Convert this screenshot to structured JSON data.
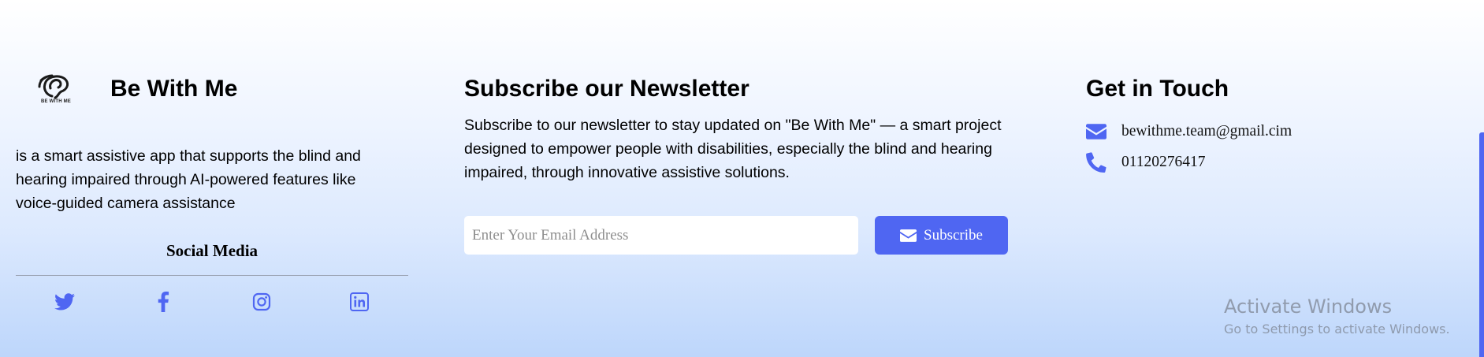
{
  "brand": {
    "logo_caption": "BE WITH ME",
    "title": "Be With Me",
    "description": "is a smart assistive app that supports the blind and hearing impaired through AI-powered features like voice-guided camera assistance"
  },
  "social": {
    "title": "Social Media",
    "links": [
      {
        "icon": "twitter-icon"
      },
      {
        "icon": "facebook-icon"
      },
      {
        "icon": "instagram-icon"
      },
      {
        "icon": "linkedin-icon"
      }
    ]
  },
  "newsletter": {
    "title": "Subscribe our Newsletter",
    "description": "Subscribe to our newsletter to stay updated on \"Be With Me\" — a smart project designed to empower people with disabilities, especially the blind and hearing impaired, through innovative assistive solutions.",
    "email_placeholder": "Enter Your Email Address",
    "email_value": "",
    "button_label": "Subscribe",
    "button_icon": "envelope-icon"
  },
  "contact": {
    "title": "Get in Touch",
    "email": "bewithme.team@gmail.cim",
    "email_icon": "envelope-icon",
    "phone": "01120276417",
    "phone_icon": "phone-icon"
  },
  "watermark": {
    "title": "Activate Windows",
    "subtitle": "Go to Settings to activate Windows."
  },
  "colors": {
    "accent": "#4f66f2",
    "background_top": "#ffffff",
    "background_bottom": "#bdd6fb",
    "text": "#000000"
  }
}
